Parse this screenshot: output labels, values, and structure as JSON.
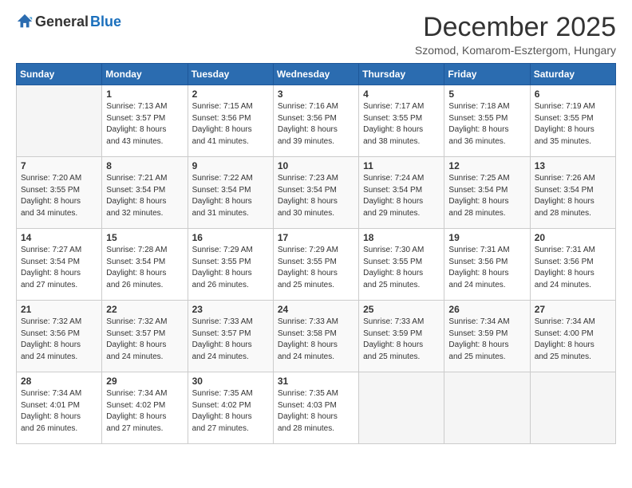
{
  "logo": {
    "general": "General",
    "blue": "Blue"
  },
  "title": {
    "month": "December 2025",
    "location": "Szomod, Komarom-Esztergom, Hungary"
  },
  "days": [
    "Sunday",
    "Monday",
    "Tuesday",
    "Wednesday",
    "Thursday",
    "Friday",
    "Saturday"
  ],
  "weeks": [
    [
      {
        "day": "",
        "content": ""
      },
      {
        "day": "1",
        "content": "Sunrise: 7:13 AM\nSunset: 3:57 PM\nDaylight: 8 hours\nand 43 minutes."
      },
      {
        "day": "2",
        "content": "Sunrise: 7:15 AM\nSunset: 3:56 PM\nDaylight: 8 hours\nand 41 minutes."
      },
      {
        "day": "3",
        "content": "Sunrise: 7:16 AM\nSunset: 3:56 PM\nDaylight: 8 hours\nand 39 minutes."
      },
      {
        "day": "4",
        "content": "Sunrise: 7:17 AM\nSunset: 3:55 PM\nDaylight: 8 hours\nand 38 minutes."
      },
      {
        "day": "5",
        "content": "Sunrise: 7:18 AM\nSunset: 3:55 PM\nDaylight: 8 hours\nand 36 minutes."
      },
      {
        "day": "6",
        "content": "Sunrise: 7:19 AM\nSunset: 3:55 PM\nDaylight: 8 hours\nand 35 minutes."
      }
    ],
    [
      {
        "day": "7",
        "content": "Sunrise: 7:20 AM\nSunset: 3:55 PM\nDaylight: 8 hours\nand 34 minutes."
      },
      {
        "day": "8",
        "content": "Sunrise: 7:21 AM\nSunset: 3:54 PM\nDaylight: 8 hours\nand 32 minutes."
      },
      {
        "day": "9",
        "content": "Sunrise: 7:22 AM\nSunset: 3:54 PM\nDaylight: 8 hours\nand 31 minutes."
      },
      {
        "day": "10",
        "content": "Sunrise: 7:23 AM\nSunset: 3:54 PM\nDaylight: 8 hours\nand 30 minutes."
      },
      {
        "day": "11",
        "content": "Sunrise: 7:24 AM\nSunset: 3:54 PM\nDaylight: 8 hours\nand 29 minutes."
      },
      {
        "day": "12",
        "content": "Sunrise: 7:25 AM\nSunset: 3:54 PM\nDaylight: 8 hours\nand 28 minutes."
      },
      {
        "day": "13",
        "content": "Sunrise: 7:26 AM\nSunset: 3:54 PM\nDaylight: 8 hours\nand 28 minutes."
      }
    ],
    [
      {
        "day": "14",
        "content": "Sunrise: 7:27 AM\nSunset: 3:54 PM\nDaylight: 8 hours\nand 27 minutes."
      },
      {
        "day": "15",
        "content": "Sunrise: 7:28 AM\nSunset: 3:54 PM\nDaylight: 8 hours\nand 26 minutes."
      },
      {
        "day": "16",
        "content": "Sunrise: 7:29 AM\nSunset: 3:55 PM\nDaylight: 8 hours\nand 26 minutes."
      },
      {
        "day": "17",
        "content": "Sunrise: 7:29 AM\nSunset: 3:55 PM\nDaylight: 8 hours\nand 25 minutes."
      },
      {
        "day": "18",
        "content": "Sunrise: 7:30 AM\nSunset: 3:55 PM\nDaylight: 8 hours\nand 25 minutes."
      },
      {
        "day": "19",
        "content": "Sunrise: 7:31 AM\nSunset: 3:56 PM\nDaylight: 8 hours\nand 24 minutes."
      },
      {
        "day": "20",
        "content": "Sunrise: 7:31 AM\nSunset: 3:56 PM\nDaylight: 8 hours\nand 24 minutes."
      }
    ],
    [
      {
        "day": "21",
        "content": "Sunrise: 7:32 AM\nSunset: 3:56 PM\nDaylight: 8 hours\nand 24 minutes."
      },
      {
        "day": "22",
        "content": "Sunrise: 7:32 AM\nSunset: 3:57 PM\nDaylight: 8 hours\nand 24 minutes."
      },
      {
        "day": "23",
        "content": "Sunrise: 7:33 AM\nSunset: 3:57 PM\nDaylight: 8 hours\nand 24 minutes."
      },
      {
        "day": "24",
        "content": "Sunrise: 7:33 AM\nSunset: 3:58 PM\nDaylight: 8 hours\nand 24 minutes."
      },
      {
        "day": "25",
        "content": "Sunrise: 7:33 AM\nSunset: 3:59 PM\nDaylight: 8 hours\nand 25 minutes."
      },
      {
        "day": "26",
        "content": "Sunrise: 7:34 AM\nSunset: 3:59 PM\nDaylight: 8 hours\nand 25 minutes."
      },
      {
        "day": "27",
        "content": "Sunrise: 7:34 AM\nSunset: 4:00 PM\nDaylight: 8 hours\nand 25 minutes."
      }
    ],
    [
      {
        "day": "28",
        "content": "Sunrise: 7:34 AM\nSunset: 4:01 PM\nDaylight: 8 hours\nand 26 minutes."
      },
      {
        "day": "29",
        "content": "Sunrise: 7:34 AM\nSunset: 4:02 PM\nDaylight: 8 hours\nand 27 minutes."
      },
      {
        "day": "30",
        "content": "Sunrise: 7:35 AM\nSunset: 4:02 PM\nDaylight: 8 hours\nand 27 minutes."
      },
      {
        "day": "31",
        "content": "Sunrise: 7:35 AM\nSunset: 4:03 PM\nDaylight: 8 hours\nand 28 minutes."
      },
      {
        "day": "",
        "content": ""
      },
      {
        "day": "",
        "content": ""
      },
      {
        "day": "",
        "content": ""
      }
    ]
  ]
}
